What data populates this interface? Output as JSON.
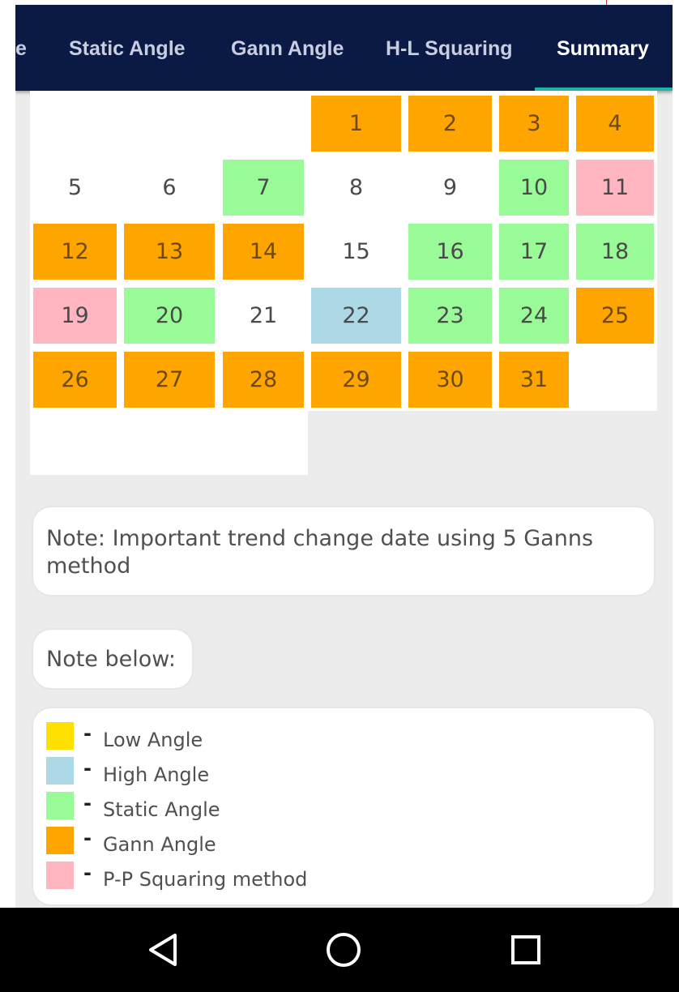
{
  "tabs": [
    {
      "label": "e",
      "active": false
    },
    {
      "label": "Static Angle",
      "active": false
    },
    {
      "label": "Gann Angle",
      "active": false
    },
    {
      "label": "H-L Squaring",
      "active": false
    },
    {
      "label": "Summary",
      "active": true
    }
  ],
  "calendar": {
    "days": [
      {
        "day": "1",
        "type": "gann"
      },
      {
        "day": "2",
        "type": "gann"
      },
      {
        "day": "3",
        "type": "gann"
      },
      {
        "day": "4",
        "type": "gann"
      },
      {
        "day": "5",
        "type": "none"
      },
      {
        "day": "6",
        "type": "none"
      },
      {
        "day": "7",
        "type": "static"
      },
      {
        "day": "8",
        "type": "none"
      },
      {
        "day": "9",
        "type": "none"
      },
      {
        "day": "10",
        "type": "static"
      },
      {
        "day": "11",
        "type": "pp"
      },
      {
        "day": "12",
        "type": "gann"
      },
      {
        "day": "13",
        "type": "gann"
      },
      {
        "day": "14",
        "type": "gann"
      },
      {
        "day": "15",
        "type": "none"
      },
      {
        "day": "16",
        "type": "static"
      },
      {
        "day": "17",
        "type": "static"
      },
      {
        "day": "18",
        "type": "static"
      },
      {
        "day": "19",
        "type": "pp"
      },
      {
        "day": "20",
        "type": "static"
      },
      {
        "day": "21",
        "type": "none"
      },
      {
        "day": "22",
        "type": "high"
      },
      {
        "day": "23",
        "type": "static"
      },
      {
        "day": "24",
        "type": "static"
      },
      {
        "day": "25",
        "type": "gann"
      },
      {
        "day": "26",
        "type": "gann"
      },
      {
        "day": "27",
        "type": "gann"
      },
      {
        "day": "28",
        "type": "gann"
      },
      {
        "day": "29",
        "type": "gann"
      },
      {
        "day": "30",
        "type": "gann"
      },
      {
        "day": "31",
        "type": "gann"
      }
    ]
  },
  "note": {
    "main": "Note: Important trend change date using 5 Ganns method",
    "below": "Note below:"
  },
  "legend": {
    "items": [
      {
        "label": "Low Angle",
        "color": "#ffe000",
        "dash": "-"
      },
      {
        "label": "High Angle",
        "color": "#add8e6",
        "dash": "-"
      },
      {
        "label": "Static Angle",
        "color": "#98fb98",
        "dash": "-"
      },
      {
        "label": "Gann Angle",
        "color": "#ffa500",
        "dash": "-"
      },
      {
        "label": "P-P Squaring method",
        "color": "#ffb6c1",
        "dash": "-"
      }
    ]
  },
  "nav": {
    "icons": [
      "back-triangle-icon",
      "home-circle-icon",
      "recents-square-icon"
    ]
  }
}
